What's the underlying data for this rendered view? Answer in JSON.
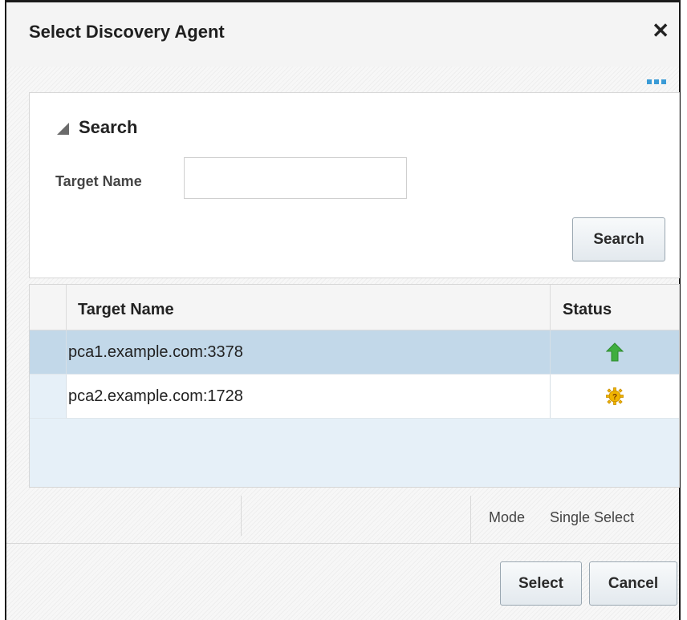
{
  "dialog": {
    "title": "Select Discovery Agent",
    "close_icon": "close-icon"
  },
  "search": {
    "title": "Search",
    "field_label": "Target Name",
    "field_value": "",
    "field_placeholder": "",
    "button_label": "Search"
  },
  "table": {
    "columns": [
      "Target Name",
      "Status"
    ],
    "rows": [
      {
        "target_name": "pca1.example.com:3378",
        "status_icon": "status-up-icon",
        "selected": true
      },
      {
        "target_name": "pca2.example.com:1728",
        "status_icon": "status-unknown-icon",
        "selected": false
      }
    ]
  },
  "status_bar": {
    "mode_label": "Mode",
    "mode_value": "Single Select"
  },
  "footer": {
    "select_label": "Select",
    "cancel_label": "Cancel"
  },
  "colors": {
    "selected_row": "#c2d8e9",
    "up_arrow": "#3fae3f",
    "unknown_gear": "#f0b400",
    "accent_dots": "#3a9bd6"
  }
}
